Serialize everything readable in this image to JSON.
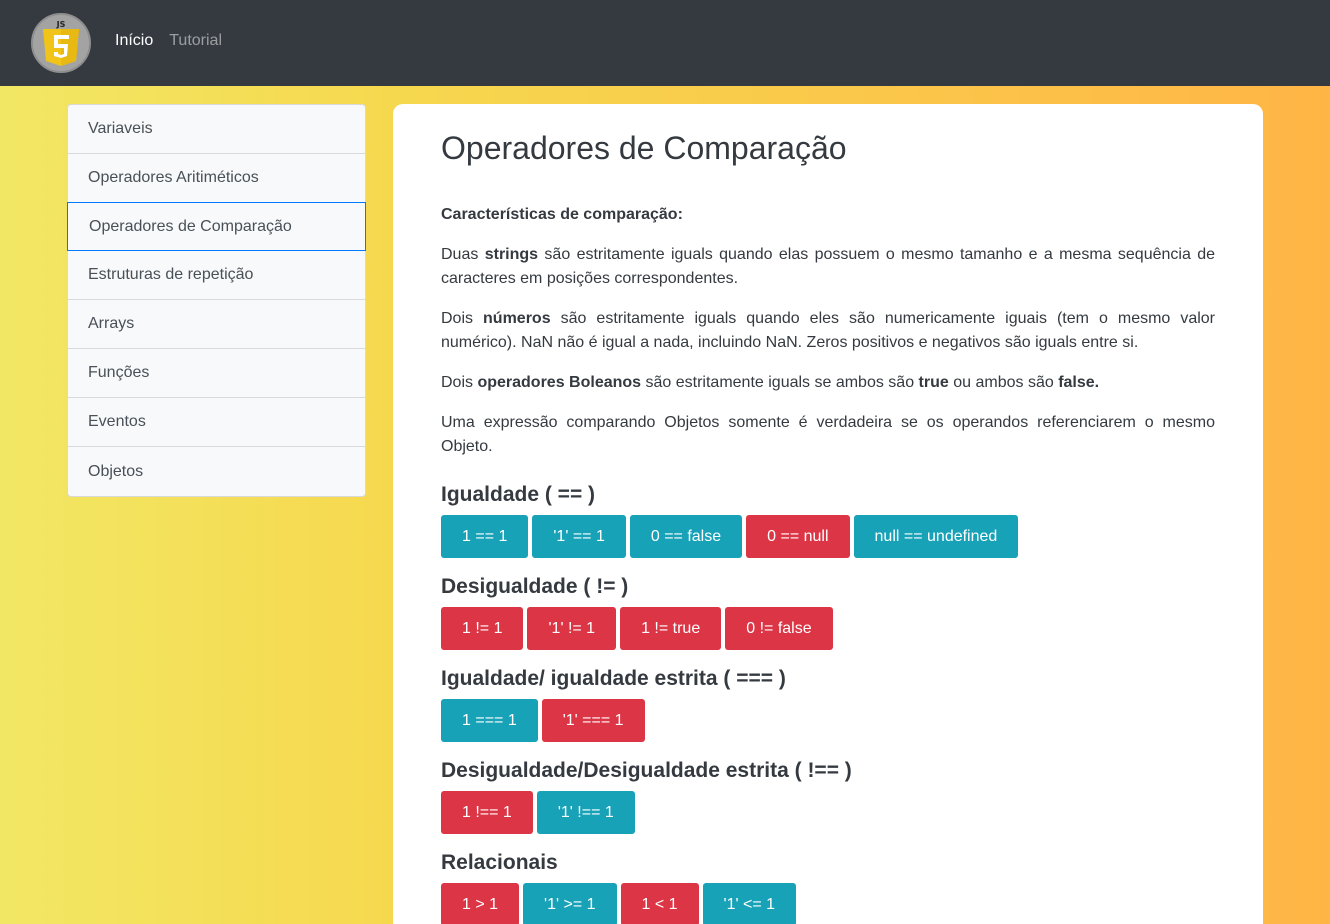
{
  "nav": {
    "logo_text": "JS 5",
    "links": [
      {
        "label": "Início",
        "active": true
      },
      {
        "label": "Tutorial",
        "active": false
      }
    ]
  },
  "sidebar": {
    "items": [
      {
        "label": "Variaveis"
      },
      {
        "label": "Operadores Aritiméticos"
      },
      {
        "label": "Operadores de Comparação",
        "active": true
      },
      {
        "label": "Estruturas de repetição"
      },
      {
        "label": "Arrays"
      },
      {
        "label": "Funções"
      },
      {
        "label": "Eventos"
      },
      {
        "label": "Objetos"
      }
    ]
  },
  "main": {
    "title": "Operadores de Comparação",
    "subtitle": "Características de comparação:",
    "p1": {
      "a": "Duas ",
      "b": "strings",
      "c": " são estritamente iguals quando elas possuem o mesmo tamanho e a mesma sequência de caracteres em posições correspondentes."
    },
    "p2": {
      "a": "Dois ",
      "b": "números",
      "c": " são estritamente iguals quando eles são numericamente iguais (tem o mesmo valor numérico). NaN não é igual a nada, incluindo NaN. Zeros positivos e negativos são iguals entre si."
    },
    "p3": {
      "a": "Dois ",
      "b": "operadores Boleanos",
      "c": " são estritamente iguals se ambos são ",
      "d": "true",
      "e": " ou ambos são ",
      "f": "false."
    },
    "p4": "Uma expressão comparando Objetos somente é verdadeira se os operandos referenciarem o mesmo Objeto.",
    "sections": [
      {
        "title": "Igualdade ( == )",
        "buttons": [
          {
            "label": "1 == 1",
            "color": "#17a2b8"
          },
          {
            "label": "'1' == 1",
            "color": "#17a2b8"
          },
          {
            "label": "0 == false",
            "color": "#17a2b8"
          },
          {
            "label": "0 == null",
            "color": "#dc3545"
          },
          {
            "label": "null == undefined",
            "color": "#17a2b8"
          }
        ]
      },
      {
        "title": "Desigualdade ( != )",
        "buttons": [
          {
            "label": "1 != 1",
            "color": "#dc3545"
          },
          {
            "label": "'1' != 1",
            "color": "#dc3545"
          },
          {
            "label": "1 != true",
            "color": "#dc3545"
          },
          {
            "label": "0 != false",
            "color": "#dc3545"
          }
        ]
      },
      {
        "title": "Igualdade/ igualdade estrita ( === )",
        "buttons": [
          {
            "label": "1 === 1",
            "color": "#17a2b8"
          },
          {
            "label": "'1' === 1",
            "color": "#dc3545"
          }
        ]
      },
      {
        "title": "Desigualdade/Desigualdade estrita ( !== )",
        "buttons": [
          {
            "label": "1 !== 1",
            "color": "#dc3545"
          },
          {
            "label": "'1' !== 1",
            "color": "#17a2b8"
          }
        ]
      },
      {
        "title": "Relacionais",
        "buttons": [
          {
            "label": "1 > 1",
            "color": "#dc3545"
          },
          {
            "label": "'1' >= 1",
            "color": "#17a2b8"
          },
          {
            "label": "1 < 1",
            "color": "#dc3545"
          },
          {
            "label": "'1' <= 1",
            "color": "#17a2b8"
          }
        ]
      }
    ]
  }
}
